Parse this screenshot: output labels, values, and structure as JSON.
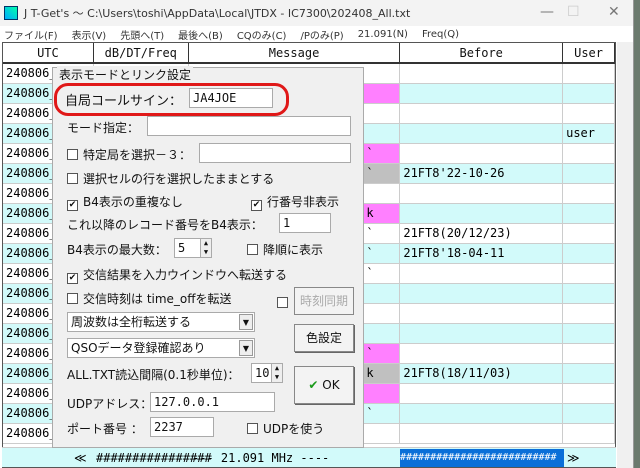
{
  "window": {
    "title": "J T-Get's 〜 C:\\Users\\toshi\\AppData\\Local\\JTDX - IC7300\\202408_All.txt",
    "minimize": "—",
    "maximize": "☐",
    "close": "✕"
  },
  "menu": [
    "ファイル(F)",
    "表示(V)",
    "先頭へ(T)",
    "最後へ(B)",
    "CQのみ(C)",
    "/Pのみ(P)",
    "21.091(N)",
    "Freq(Q)"
  ],
  "columns": [
    "UTC",
    "dB/DT/Freq",
    "Message",
    "Before",
    "User"
  ],
  "rows": [
    {
      "utc": "240806_",
      "mark": "",
      "markColor": "",
      "before": "",
      "user": ""
    },
    {
      "utc": "240806_",
      "mark": "",
      "markColor": "#ff80ff",
      "before": "",
      "user": ""
    },
    {
      "utc": "240806_",
      "mark": "",
      "markColor": "",
      "before": "",
      "user": ""
    },
    {
      "utc": "240806_",
      "mark": "",
      "markColor": "",
      "before": "",
      "user": "user"
    },
    {
      "utc": "240806_",
      "mark": "`",
      "markColor": "#ff80ff",
      "before": "",
      "user": ""
    },
    {
      "utc": "240806_",
      "mark": "`",
      "markColor": "#c0c0c0",
      "before": "21FT8'22-10-26",
      "user": ""
    },
    {
      "utc": "240806_",
      "mark": "",
      "markColor": "",
      "before": "",
      "user": ""
    },
    {
      "utc": "240806_",
      "mark": "k",
      "markColor": "#ff80ff",
      "before": "",
      "user": ""
    },
    {
      "utc": "240806_",
      "mark": "`",
      "markColor": "",
      "before": "21FT8(20/12/23)",
      "user": ""
    },
    {
      "utc": "240806_",
      "mark": "`",
      "markColor": "",
      "before": "21FT8'18-04-11",
      "user": ""
    },
    {
      "utc": "240806_",
      "mark": "`",
      "markColor": "",
      "before": "",
      "user": ""
    },
    {
      "utc": "240806_",
      "mark": "",
      "markColor": "",
      "before": "",
      "user": ""
    },
    {
      "utc": "240806_",
      "mark": "",
      "markColor": "",
      "before": "",
      "user": ""
    },
    {
      "utc": "240806_",
      "mark": "",
      "markColor": "",
      "before": "",
      "user": ""
    },
    {
      "utc": "240806_",
      "mark": "`",
      "markColor": "#ff80ff",
      "before": "",
      "user": ""
    },
    {
      "utc": "240806_",
      "mark": "k",
      "markColor": "#c0c0c0",
      "before": "21FT8(18/11/03)",
      "user": ""
    },
    {
      "utc": "240806_",
      "mark": "",
      "markColor": "#ff80ff",
      "before": "",
      "user": ""
    },
    {
      "utc": "240806_",
      "mark": "`",
      "markColor": "",
      "before": "",
      "user": ""
    },
    {
      "utc": "240806_",
      "mark": "",
      "markColor": "",
      "before": "",
      "user": ""
    }
  ],
  "footer": {
    "left_arrow": "≪",
    "hashes": "################",
    "freq": "--- 21.091 MHz ----",
    "bar": "##########################",
    "right_arrow": "≫"
  },
  "dialog": {
    "title": "表示モードとリンク設定",
    "callsign_label": "自局コールサイン：",
    "callsign": "JA4JOE",
    "mode_label": "モード指定：",
    "mode": "",
    "specific_label": "特定局を選択－３：",
    "specific": "",
    "keep_sel_label": "選択セルの行を選択したままとする",
    "b4_nodup_label": "B4表示の重複なし",
    "hide_rownum_label": "行番号非表示",
    "record_label": "これ以降のレコード番号をB4表示：",
    "record": "1",
    "b4max_label": "B4表示の最大数：",
    "b4max": "5",
    "desc_label": "降順に表示",
    "transfer_label": "交信結果を入力ウインドウへ転送する",
    "timeoff_label": "交信時刻は time_offを転送",
    "timesync_label": "時刻同期",
    "freq_select": "周波数は全桁転送する",
    "qso_select": "QSOデータ登録確認あり",
    "color_button": "色設定",
    "interval_label": "ALL.TXT読込間隔(0.1秒単位)：",
    "interval": "10",
    "ok_button": "OK",
    "udp_addr_label": "UDPアドレス：",
    "udp_addr": "127.0.0.1",
    "port_label": "ポート番号 ：",
    "port": "2237",
    "use_udp_label": "UDPを使う"
  }
}
